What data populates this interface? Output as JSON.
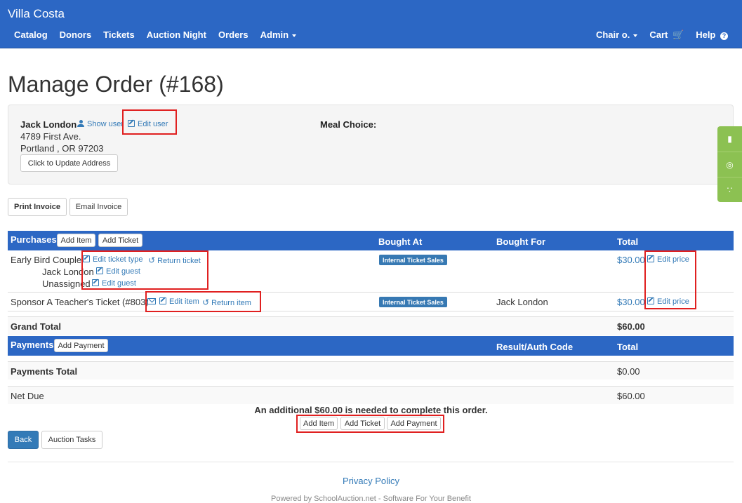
{
  "nav": {
    "brand": "Villa Costa",
    "left": [
      "Catalog",
      "Donors",
      "Tickets",
      "Auction Night",
      "Orders",
      "Admin"
    ],
    "right": [
      "Chair o.",
      "Cart",
      "Help"
    ]
  },
  "page_title": "Manage Order (#168)",
  "customer": {
    "name": "Jack London",
    "show_user": "Show user",
    "edit_user": "Edit user",
    "address1": "4789 First Ave.",
    "address2": "Portland , OR 97203",
    "update_address": "Click to Update Address",
    "meal_choice_label": "Meal Choice:"
  },
  "invoice": {
    "print": "Print Invoice",
    "email": "Email Invoice"
  },
  "purchases": {
    "header": "Purchases",
    "add_item": "Add Item",
    "add_ticket": "Add Ticket",
    "col_bought_at": "Bought At",
    "col_bought_for": "Bought For",
    "col_total": "Total",
    "rows": [
      {
        "name": "Early Bird Couple",
        "edit_ticket_type": "Edit ticket type",
        "return_ticket": "Return ticket",
        "guest1": "Jack London",
        "guest2": "Unassigned",
        "edit_guest": "Edit guest",
        "bought_at": "Internal Ticket Sales",
        "bought_for": "",
        "total": "$30.00",
        "edit_price": "Edit price"
      },
      {
        "name": "Sponsor A Teacher's Ticket (#803)",
        "edit_item": "Edit item",
        "return_item": "Return item",
        "bought_at": "Internal Ticket Sales",
        "bought_for": "Jack London",
        "total": "$30.00",
        "edit_price": "Edit price"
      }
    ],
    "grand_total_label": "Grand Total",
    "grand_total": "$60.00"
  },
  "payments": {
    "header": "Payments",
    "add_payment": "Add Payment",
    "col_result": "Result/Auth Code",
    "col_total": "Total",
    "total_label": "Payments Total",
    "total": "$0.00",
    "net_due_label": "Net Due",
    "net_due": "$60.00"
  },
  "notice": "An additional $60.00 is needed to complete this order.",
  "bottom_buttons": {
    "add_item": "Add Item",
    "add_ticket": "Add Ticket",
    "add_payment": "Add Payment"
  },
  "actions": {
    "back": "Back",
    "auction_tasks": "Auction Tasks"
  },
  "footer": {
    "privacy": "Privacy Policy",
    "powered": "Powered by SchoolAuction.net - Software For Your Benefit"
  },
  "colors": {
    "navbar": "#2c67c4",
    "link": "#337ab7",
    "badge": "#3779b3",
    "highlight": "#e02020",
    "side_tabs": "#8cc152"
  }
}
